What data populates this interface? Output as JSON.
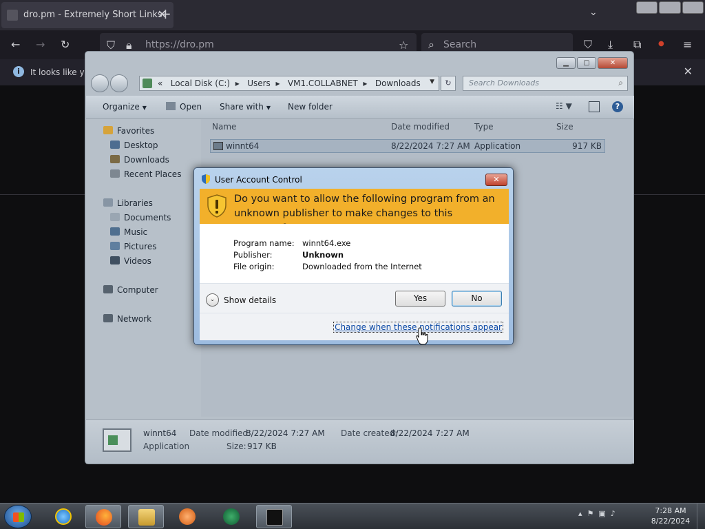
{
  "browser": {
    "tab_title": "dro.pm - Extremely Short Links",
    "tab_close": "✕",
    "new_tab": "+",
    "url": "https://dro.pm",
    "search_placeholder": "Search",
    "notice_text": "It looks like you",
    "notice_close": "✕"
  },
  "explorer": {
    "address_prefix": "«",
    "breadcrumbs": [
      "Local Disk (C:)",
      "Users",
      "VM1.COLLABNET",
      "Downloads"
    ],
    "search_placeholder": "Search Downloads",
    "toolbar": {
      "organize": "Organize",
      "open": "Open",
      "share_with": "Share with",
      "new_folder": "New folder"
    },
    "nav": {
      "favorites": "Favorites",
      "desktop": "Desktop",
      "downloads": "Downloads",
      "recent_places": "Recent Places",
      "libraries": "Libraries",
      "documents": "Documents",
      "music": "Music",
      "pictures": "Pictures",
      "videos": "Videos",
      "computer": "Computer",
      "network": "Network"
    },
    "columns": {
      "name": "Name",
      "date_modified": "Date modified",
      "type": "Type",
      "size": "Size"
    },
    "files": [
      {
        "name": "winnt64",
        "date": "8/22/2024 7:27 AM",
        "type": "Application",
        "size": "917 KB"
      }
    ],
    "details": {
      "name": "winnt64",
      "type": "Application",
      "date_modified_label": "Date modified:",
      "date_modified": "8/22/2024 7:27 AM",
      "date_created_label": "Date created:",
      "date_created": "8/22/2024 7:27 AM",
      "size_label": "Size:",
      "size": "917 KB"
    }
  },
  "uac": {
    "title": "User Account Control",
    "close": "✕",
    "question": "Do you want to allow the following program from an unknown publisher to make changes to this computer?",
    "program_name_label": "Program name:",
    "program_name": "winnt64.exe",
    "publisher_label": "Publisher:",
    "publisher": "Unknown",
    "file_origin_label": "File origin:",
    "file_origin": "Downloaded from the Internet",
    "show_details": "Show details",
    "yes": "Yes",
    "no": "No",
    "change_link": "Change when these notifications appear",
    "accent_color": "#f2b02b"
  },
  "taskbar": {
    "time": "7:28 AM",
    "date": "8/22/2024"
  }
}
